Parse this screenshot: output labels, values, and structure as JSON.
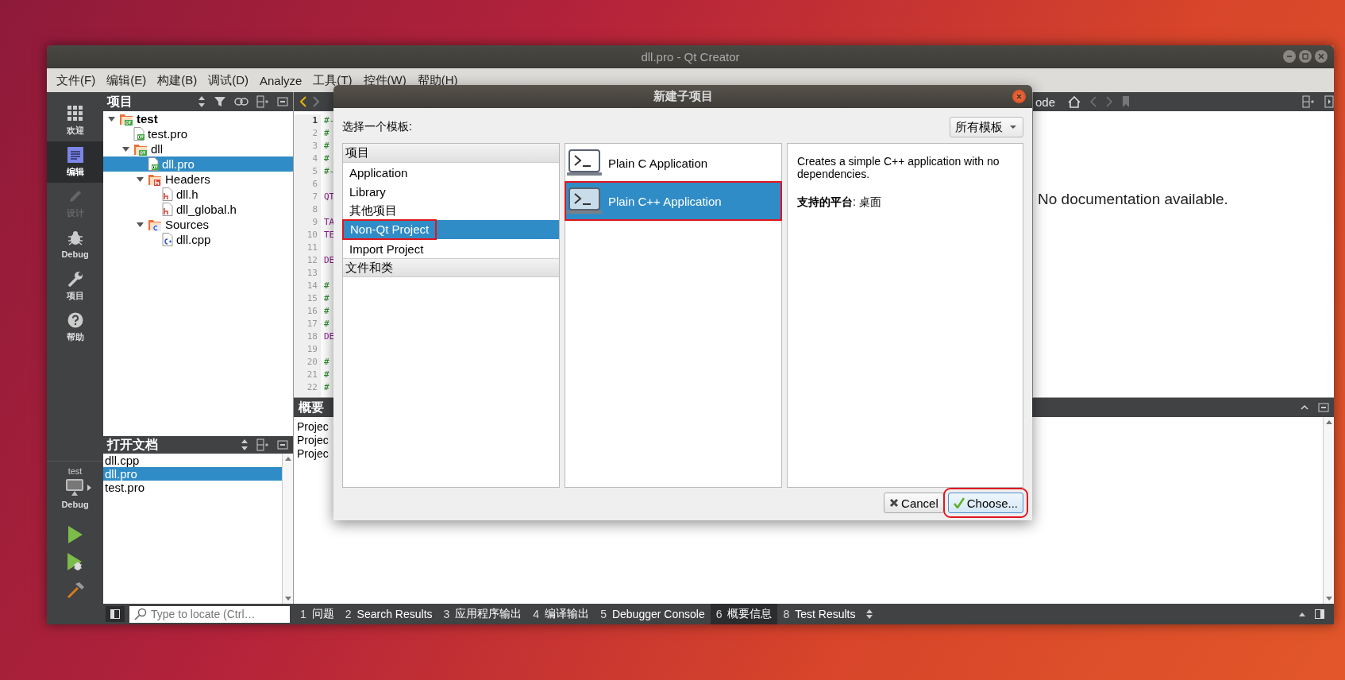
{
  "window": {
    "title": "dll.pro - Qt Creator"
  },
  "menu": [
    "文件(F)",
    "编辑(E)",
    "构建(B)",
    "调试(D)",
    "Analyze",
    "工具(T)",
    "控件(W)",
    "帮助(H)"
  ],
  "modes": [
    {
      "label": "欢迎",
      "kind": "welcome",
      "selected": false,
      "disabled": false
    },
    {
      "label": "编辑",
      "kind": "edit",
      "selected": true,
      "disabled": false
    },
    {
      "label": "设计",
      "kind": "design",
      "selected": false,
      "disabled": true
    },
    {
      "label": "Debug",
      "kind": "debug",
      "selected": false,
      "disabled": false
    },
    {
      "label": "项目",
      "kind": "projects",
      "selected": false,
      "disabled": false
    },
    {
      "label": "帮助",
      "kind": "help",
      "selected": false,
      "disabled": false
    }
  ],
  "target": {
    "project": "test",
    "build": "Debug"
  },
  "project_pane": {
    "title": "项目",
    "tree": [
      {
        "label": "test",
        "kind": "project",
        "expanded": true,
        "selected": false,
        "children": [
          {
            "label": "test.pro",
            "kind": "pro",
            "selected": false
          },
          {
            "label": "dll",
            "kind": "project",
            "expanded": true,
            "selected": false,
            "children": [
              {
                "label": "dll.pro",
                "kind": "pro",
                "selected": true
              },
              {
                "label": "Headers",
                "kind": "headers",
                "expanded": true,
                "selected": false,
                "children": [
                  {
                    "label": "dll.h",
                    "kind": "header",
                    "selected": false
                  },
                  {
                    "label": "dll_global.h",
                    "kind": "header",
                    "selected": false
                  }
                ]
              },
              {
                "label": "Sources",
                "kind": "sources",
                "expanded": true,
                "selected": false,
                "children": [
                  {
                    "label": "dll.cpp",
                    "kind": "source",
                    "selected": false
                  }
                ]
              }
            ]
          }
        ]
      }
    ]
  },
  "open_documents": {
    "title": "打开文档",
    "items": [
      {
        "label": "dll.cpp",
        "selected": false
      },
      {
        "label": "dll.pro",
        "selected": true
      },
      {
        "label": "test.pro",
        "selected": false
      }
    ]
  },
  "editor": {
    "lines": [
      {
        "number": "1",
        "text": "#-",
        "kind": "comment",
        "current": true
      },
      {
        "number": "2",
        "text": "#",
        "kind": "comment",
        "current": false
      },
      {
        "number": "3",
        "text": "#",
        "kind": "comment",
        "current": false
      },
      {
        "number": "4",
        "text": "#",
        "kind": "comment",
        "current": false
      },
      {
        "number": "5",
        "text": "#-",
        "kind": "comment",
        "current": false
      },
      {
        "number": "6",
        "current": false
      },
      {
        "number": "7",
        "text": "QT",
        "kind": "keyword",
        "current": false
      },
      {
        "number": "8",
        "current": false
      },
      {
        "number": "9",
        "text": "TA",
        "kind": "keyword",
        "current": false
      },
      {
        "number": "10",
        "text": "TE",
        "kind": "keyword",
        "current": false
      },
      {
        "number": "11",
        "current": false
      },
      {
        "number": "12",
        "text": "DE",
        "kind": "keyword",
        "current": false
      },
      {
        "number": "13",
        "current": false
      },
      {
        "number": "14",
        "text": "#",
        "kind": "comment",
        "current": false
      },
      {
        "number": "15",
        "text": "#",
        "kind": "comment",
        "current": false
      },
      {
        "number": "16",
        "text": "#",
        "kind": "comment",
        "current": false
      },
      {
        "number": "17",
        "text": "#",
        "kind": "comment",
        "current": false
      },
      {
        "number": "18",
        "text": "DE",
        "kind": "keyword",
        "current": false
      },
      {
        "number": "19",
        "current": false
      },
      {
        "number": "20",
        "text": "#",
        "kind": "comment",
        "current": false
      },
      {
        "number": "21",
        "text": "#",
        "kind": "comment",
        "current": false
      },
      {
        "number": "22",
        "text": "#",
        "kind": "comment",
        "current": false
      }
    ]
  },
  "help": {
    "toolbar_text": "ode",
    "message": "No documentation available."
  },
  "output_pane": {
    "title": "概要",
    "lines": [
      "Projec",
      "Projec",
      "Projec"
    ]
  },
  "locator": {
    "placeholder": "Type to locate (Ctrl…"
  },
  "output_tabs": [
    {
      "number": "1",
      "label": "问题",
      "selected": false
    },
    {
      "number": "2",
      "label": "Search Results",
      "selected": false
    },
    {
      "number": "3",
      "label": "应用程序输出",
      "selected": false
    },
    {
      "number": "4",
      "label": "编译输出",
      "selected": false
    },
    {
      "number": "5",
      "label": "Debugger Console",
      "selected": false
    },
    {
      "number": "6",
      "label": "概要信息",
      "selected": true
    },
    {
      "number": "8",
      "label": "Test Results",
      "selected": false
    }
  ],
  "dialog": {
    "title": "新建子项目",
    "prompt": "选择一个模板:",
    "filter": "所有模板",
    "categories": [
      {
        "title": "项目",
        "items": [
          {
            "label": "Application",
            "selected": false,
            "highlighted": false
          },
          {
            "label": "Library",
            "selected": false,
            "highlighted": false
          },
          {
            "label": "其他项目",
            "selected": false,
            "highlighted": false
          },
          {
            "label": "Non-Qt Project",
            "selected": true,
            "highlighted": true
          },
          {
            "label": "Import Project",
            "selected": false,
            "highlighted": false
          }
        ]
      },
      {
        "title": "文件和类"
      }
    ],
    "templates": [
      {
        "label": "Plain C Application",
        "selected": false,
        "highlighted": false
      },
      {
        "label": "Plain C++ Application",
        "selected": true,
        "highlighted": true
      }
    ],
    "description": "Creates a simple C++ application with no dependencies.",
    "platforms": "**支持的平台**: 桌面",
    "buttons": [
      {
        "label": "Cancel",
        "kind": "cancel",
        "highlighted": false
      },
      {
        "label": "Choose...",
        "kind": "choose",
        "highlighted": true
      }
    ]
  }
}
